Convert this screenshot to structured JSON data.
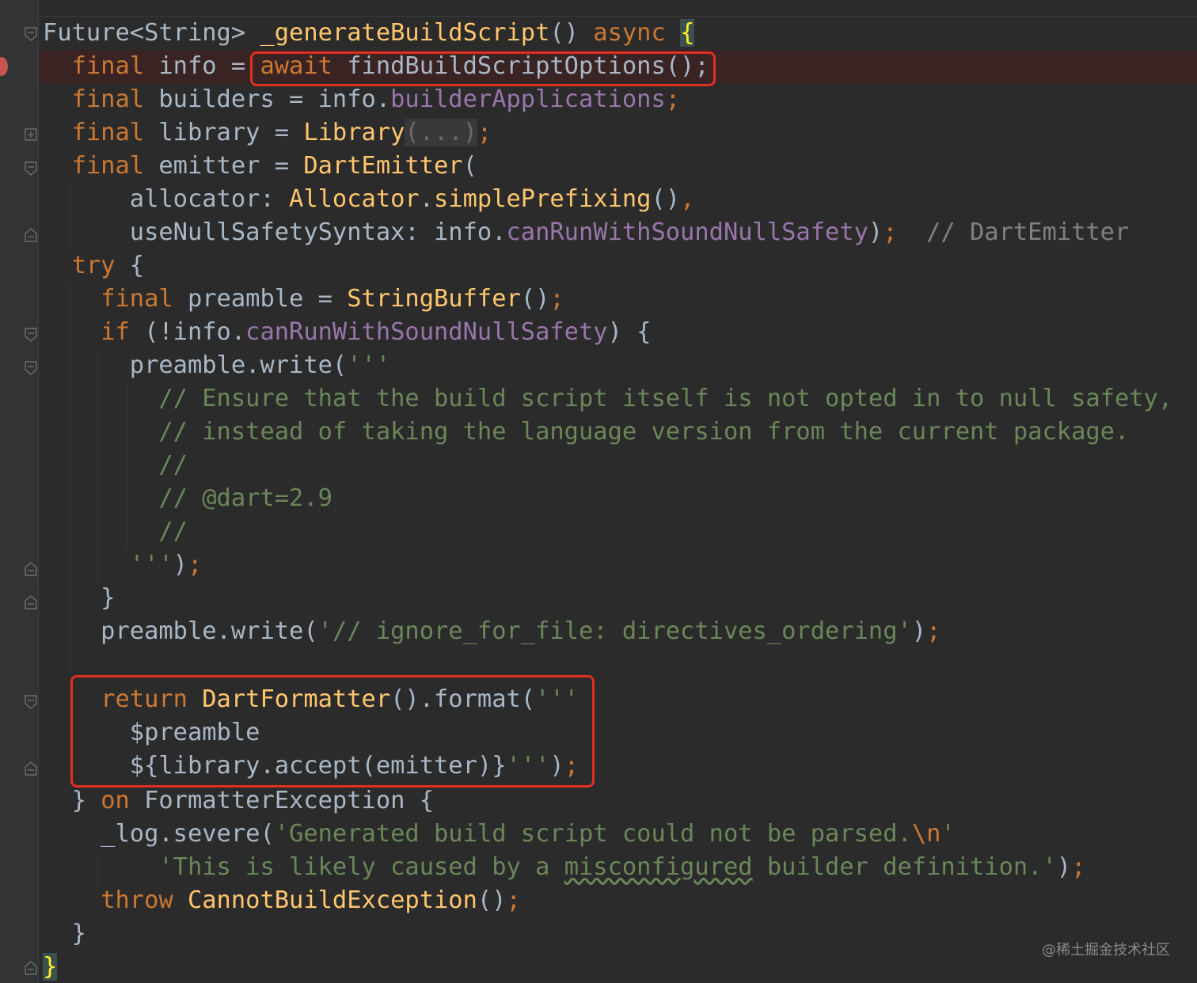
{
  "editor": {
    "language": "dart",
    "lines": [
      [
        "Future<String> ",
        "_generateBuildScript",
        "() ",
        "async",
        " ",
        "{"
      ],
      [
        "  ",
        "final",
        " info = ",
        "await",
        " findBuildScriptOptions();"
      ],
      [
        "  ",
        "final",
        " builders = info.",
        "builderApplications",
        ";"
      ],
      [
        "  ",
        "final",
        " library = ",
        "Library",
        "(...)",
        ";"
      ],
      [
        "  ",
        "final",
        " emitter = ",
        "DartEmitter",
        "("
      ],
      [
        "      allocator: ",
        "Allocator",
        ".",
        "simplePrefixing",
        "()",
        ","
      ],
      [
        "      useNullSafetySyntax: info.",
        "canRunWithSoundNullSafety",
        ")",
        ";",
        "  // DartEmitter"
      ],
      [
        "  ",
        "try",
        " {"
      ],
      [
        "    ",
        "final",
        " preamble = ",
        "StringBuffer",
        "()",
        ";"
      ],
      [
        "    ",
        "if",
        " (!info.",
        "canRunWithSoundNullSafety",
        ") {"
      ],
      [
        "      preamble.write(",
        "'''"
      ],
      [
        "        // Ensure that the build script itself is not opted in to null safety,"
      ],
      [
        "        // instead of taking the language version from the current package."
      ],
      [
        "        //"
      ],
      [
        "        // @dart=2.9"
      ],
      [
        "        //"
      ],
      [
        "      ",
        "'''",
        ")",
        ";"
      ],
      [
        "    }"
      ],
      [
        "    preamble.write(",
        "'// ignore_for_file: directives_ordering'",
        ")",
        ";"
      ],
      [
        ""
      ],
      [
        "    ",
        "return",
        " ",
        "DartFormatter",
        "().format(",
        "'''"
      ],
      [
        "      ",
        "$preamble"
      ],
      [
        "      ",
        "${",
        "library.accept(emitter)",
        "}",
        "'''",
        ")",
        ";"
      ],
      [
        "  } ",
        "on",
        " FormatterException {"
      ],
      [
        "    _log.severe(",
        "'Generated build script could not be parsed.",
        "\\n",
        "'"
      ],
      [
        "        ",
        "'This is likely caused by a ",
        "misconfigured",
        " builder definition.'",
        ")",
        ";"
      ],
      [
        "    ",
        "throw",
        " ",
        "CannotBuildException",
        "()",
        ";"
      ],
      [
        "  }"
      ],
      [
        "}"
      ]
    ]
  },
  "watermark": "@稀土掘金技术社区"
}
